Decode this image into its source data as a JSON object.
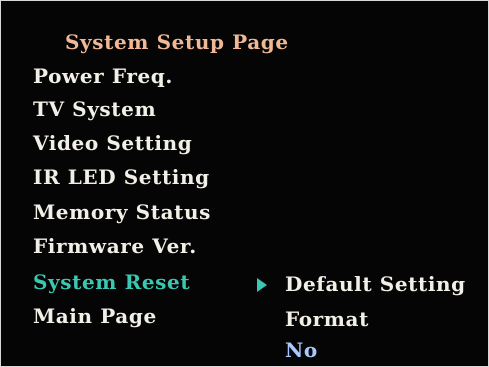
{
  "menu": {
    "title": "System Setup Page",
    "items": [
      {
        "label": "Power Freq."
      },
      {
        "label": "TV System"
      },
      {
        "label": "Video Setting"
      },
      {
        "label": "IR LED Setting"
      },
      {
        "label": "Memory Status"
      },
      {
        "label": "Firmware Ver."
      },
      {
        "label": "System Reset",
        "selected": true
      },
      {
        "label": "Main Page"
      }
    ]
  },
  "submenu": {
    "items": [
      {
        "label": "Default Setting",
        "pointed": true
      },
      {
        "label": "Format"
      },
      {
        "label": "No",
        "highlighted": true
      }
    ]
  },
  "colors": {
    "background": "#050505",
    "title_text": "#f0b894",
    "normal_text": "#f2efe6",
    "selected_text": "#39c9b3",
    "highlighted_text": "#a8c8ff",
    "pointer": "#39c9b3",
    "frame": "#d8d8d8"
  },
  "icons": {
    "pointer": "triangle-right-icon"
  }
}
